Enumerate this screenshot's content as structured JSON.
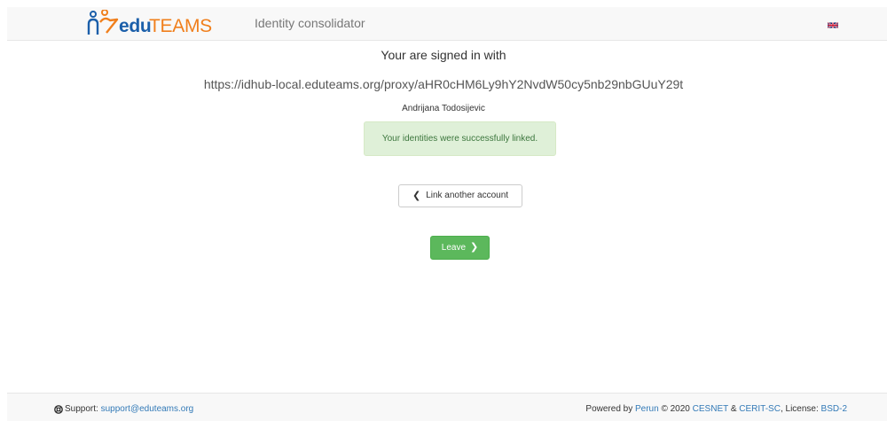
{
  "header": {
    "logo_part1": "edu",
    "logo_part2": "TEAMS",
    "app_name": "Identity consolidator",
    "language_flag": "uk-flag-icon"
  },
  "main": {
    "signed_in_title": "Your are signed in with",
    "proxy_url": "https://idhub-local.eduteams.org/proxy/aHR0cHM6Ly9hY2NvdW50cy5nb29nbGUuY29t",
    "user_name": "Andrijana Todosijevic",
    "success_message": "Your identities were successfully linked.",
    "link_another_label": "Link another account",
    "leave_label": "Leave"
  },
  "footer": {
    "support_label": "Support:",
    "support_email": "support@eduteams.org",
    "powered_by": "Powered by",
    "perun": "Perun",
    "copyright": "© 2020",
    "cesnet": "CESNET",
    "amp": "&",
    "cerit": "CERIT-SC",
    "license_label": ", License:",
    "license": "BSD-2"
  },
  "colors": {
    "brand_blue": "#1b5faa",
    "brand_orange": "#f07f1c",
    "success_bg": "#dff0d8",
    "success_text": "#3c763d",
    "leave_green": "#5cb85c",
    "link_blue": "#337ab7"
  }
}
